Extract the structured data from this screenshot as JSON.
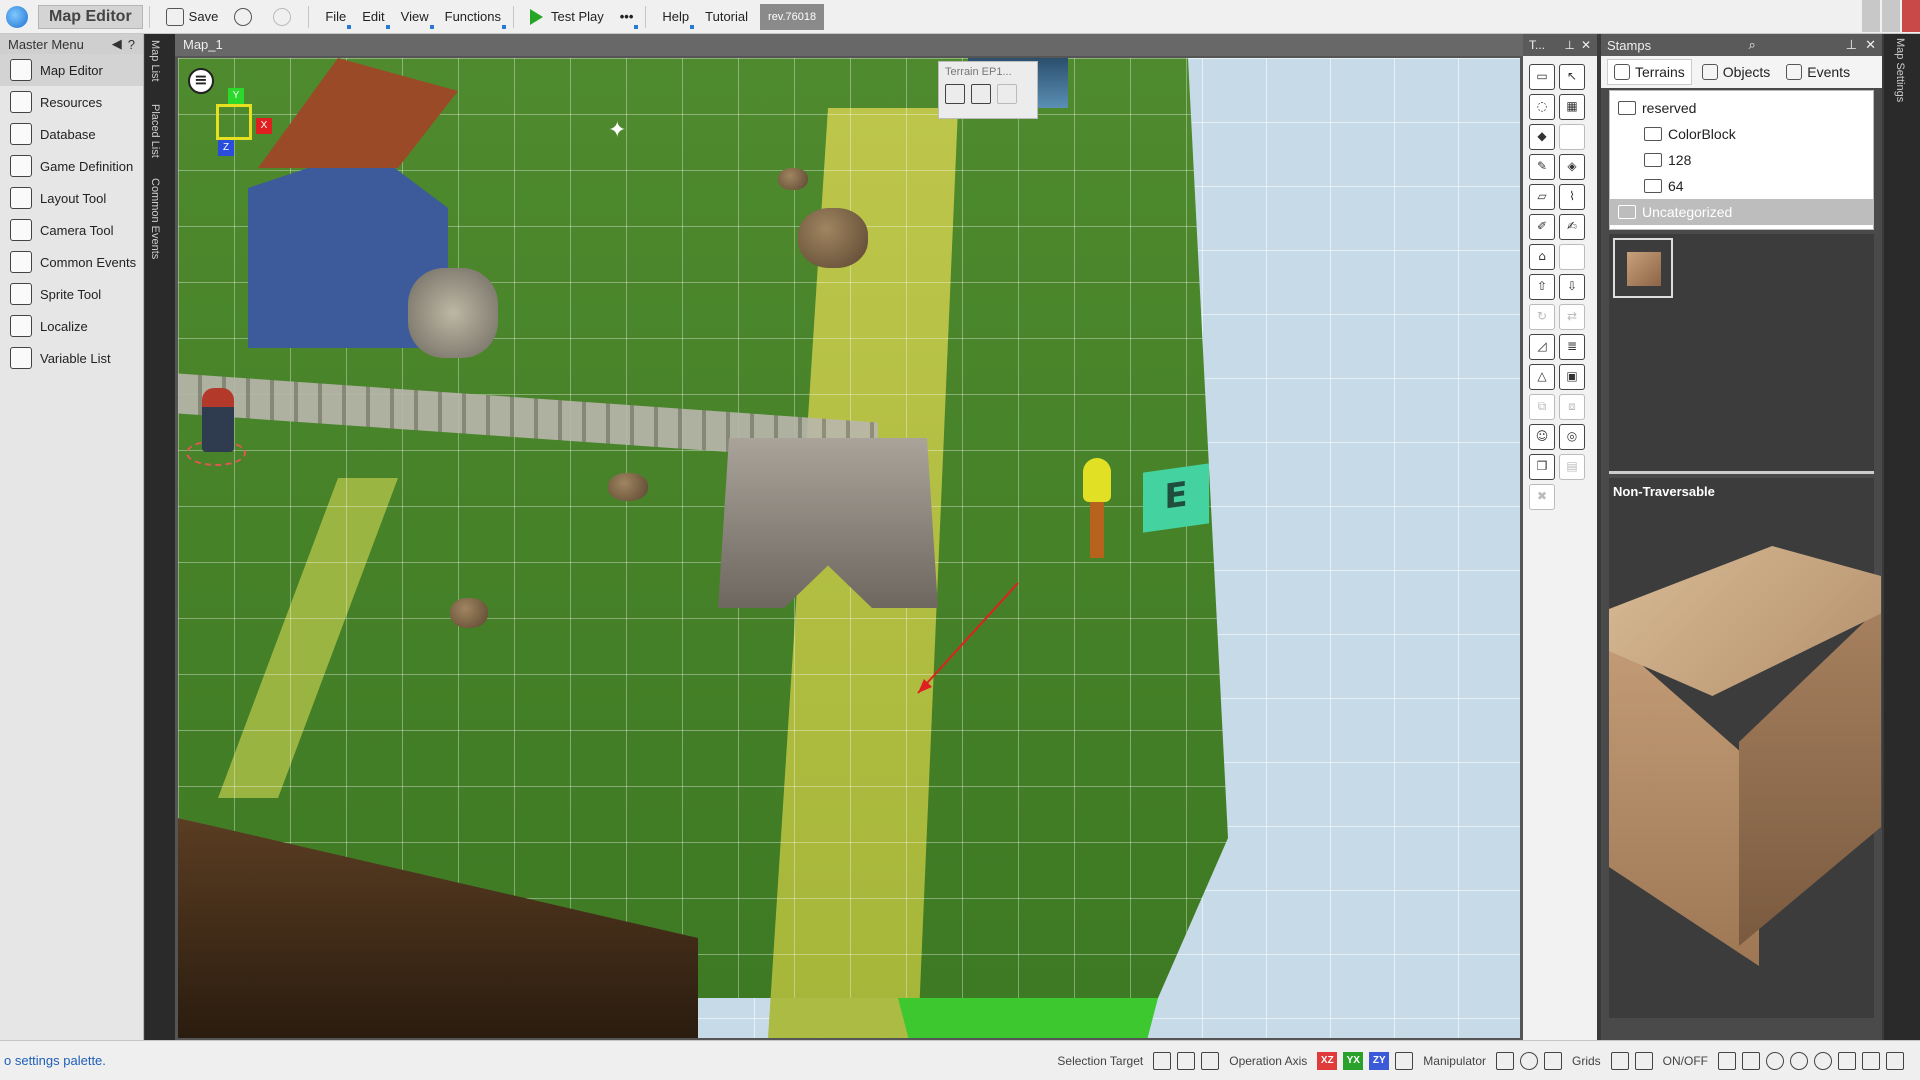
{
  "app": {
    "title": "Map Editor",
    "revision": "rev.76018"
  },
  "toolbar": {
    "save_label": "Save",
    "menus": [
      "File",
      "Edit",
      "View",
      "Functions"
    ],
    "test_play_label": "Test Play",
    "more_label": "•••",
    "help_label": "Help",
    "tutorial_label": "Tutorial"
  },
  "master_menu": {
    "title": "Master Menu",
    "help_label": "?",
    "items": [
      {
        "label": "Map Editor",
        "icon": "map-editor-icon",
        "active": true
      },
      {
        "label": "Resources",
        "icon": "resources-icon"
      },
      {
        "label": "Database",
        "icon": "database-icon"
      },
      {
        "label": "Game Definition",
        "icon": "game-definition-icon"
      },
      {
        "label": "Layout Tool",
        "icon": "layout-tool-icon"
      },
      {
        "label": "Camera Tool",
        "icon": "camera-tool-icon"
      },
      {
        "label": "Common Events",
        "icon": "common-events-icon"
      },
      {
        "label": "Sprite Tool",
        "icon": "sprite-tool-icon"
      },
      {
        "label": "Localize",
        "icon": "localize-icon"
      },
      {
        "label": "Variable List",
        "icon": "variable-list-icon"
      }
    ]
  },
  "side_tabs": [
    "Map List",
    "Placed List",
    "Common Events"
  ],
  "viewport": {
    "tab": "Map_1",
    "terrain_popup_label": "Terrain EP1...",
    "axis": {
      "x": "X",
      "y": "Y",
      "z": "Z"
    },
    "event_cube_letter": "E"
  },
  "tools_panel": {
    "title": "T..."
  },
  "stamps": {
    "title": "Stamps",
    "tabs": [
      "Terrains",
      "Objects",
      "Events"
    ],
    "active_tab": "Terrains",
    "tree": [
      {
        "label": "reserved",
        "level": 0
      },
      {
        "label": "ColorBlock",
        "level": 1
      },
      {
        "label": "128",
        "level": 1
      },
      {
        "label": "64",
        "level": 1
      },
      {
        "label": "Uncategorized",
        "level": 0,
        "selected": true
      }
    ],
    "preview_label": "Non-Traversable"
  },
  "map_settings_tab": "Map Settings",
  "statusbar": {
    "message": "o settings palette.",
    "selection_target_label": "Selection Target",
    "operation_axis_label": "Operation Axis",
    "axis_tags": [
      "XZ",
      "YX",
      "ZY"
    ],
    "axis_colors": [
      "#e03a3a",
      "#2aa12a",
      "#3a5ad8"
    ],
    "manipulator_label": "Manipulator",
    "grids_label": "Grids",
    "onoff_label": "ON/OFF"
  }
}
